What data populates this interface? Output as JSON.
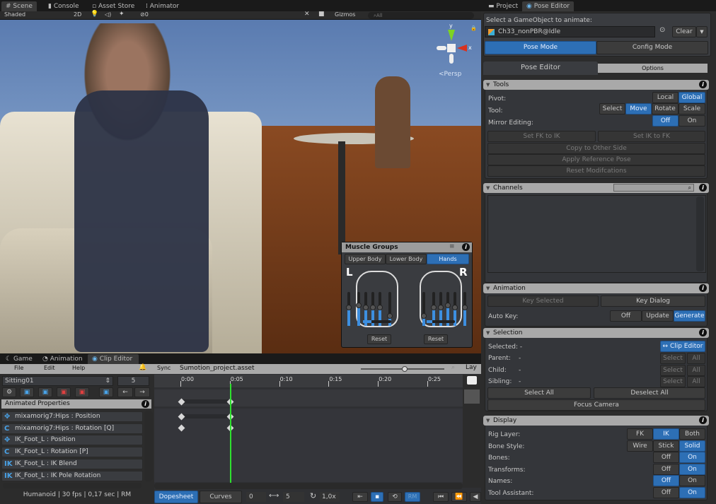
{
  "scene_panel": {
    "tabs": [
      "Scene",
      "Console",
      "Asset Store",
      "Animator"
    ],
    "shading": "Shaded",
    "mode_2d": "2D",
    "hidden_count": "0",
    "gizmos": "Gizmos",
    "search_placeholder": "All",
    "projection": "Persp",
    "axis_y": "y",
    "axis_x": "x"
  },
  "muscle_groups": {
    "title": "Muscle Groups",
    "tabs": [
      "Upper Body",
      "Lower Body",
      "Hands"
    ],
    "active_tab": "Hands",
    "left_label": "L",
    "right_label": "R",
    "reset": "Reset",
    "left_sliders": [
      0.55,
      0.6,
      0.55,
      0.55,
      0.55,
      0.3
    ],
    "right_sliders": [
      0.3,
      0.55,
      0.55,
      0.6,
      0.55,
      0.55
    ],
    "left_spread": 0.3,
    "right_spread": 0.2
  },
  "right_panel": {
    "tabs": [
      "Project",
      "Pose Editor"
    ],
    "select_label": "Select a GameObject to animate:",
    "object_name": "Ch33_nonPBR@Idle",
    "clear": "Clear",
    "modes": [
      "Pose Mode",
      "Config Mode"
    ],
    "active_mode": "Pose Mode",
    "subtabs": [
      "Pose Editor",
      "Options"
    ],
    "tools": {
      "title": "Tools",
      "pivot_label": "Pivot:",
      "pivot_options": [
        "Local",
        "Global"
      ],
      "pivot_active": "Global",
      "tool_label": "Tool:",
      "tool_options": [
        "Select",
        "Move",
        "Rotate",
        "Scale"
      ],
      "tool_active": "Move",
      "mirror_label": "Mirror Editing:",
      "mirror_options": [
        "Off",
        "On"
      ],
      "mirror_active": "Off",
      "buttons": [
        "Set FK to IK",
        "Set IK to FK",
        "Copy to Other Side",
        "Apply Reference Pose",
        "Reset Modifcations"
      ]
    },
    "channels": {
      "title": "Channels",
      "search_placeholder": ""
    },
    "animation": {
      "title": "Animation",
      "key_selected": "Key Selected",
      "key_dialog": "Key Dialog",
      "auto_key_label": "Auto Key:",
      "auto_key_options": [
        "Off",
        "Update",
        "Generate"
      ],
      "auto_key_active": "Generate"
    },
    "selection": {
      "title": "Selection",
      "selected_label": "Selected:",
      "selected_value": "-",
      "clip_editor": "↔ Clip Editor",
      "rows": [
        {
          "label": "Parent:",
          "value": "-"
        },
        {
          "label": "Child:",
          "value": "-"
        },
        {
          "label": "Sibling:",
          "value": "-"
        }
      ],
      "select": "Select",
      "all": "All",
      "select_all": "Select All",
      "deselect_all": "Deselect All",
      "focus_camera": "Focus Camera"
    },
    "display": {
      "title": "Display",
      "rows": [
        {
          "label": "Rig Layer:",
          "options": [
            "FK",
            "IK",
            "Both"
          ],
          "active": "IK"
        },
        {
          "label": "Bone Style:",
          "options": [
            "Wire",
            "Stick",
            "Solid"
          ],
          "active": "Solid"
        },
        {
          "label": "Bones:",
          "options": [
            "Off",
            "On"
          ],
          "active": "On"
        },
        {
          "label": "Transforms:",
          "options": [
            "Off",
            "On"
          ],
          "active": "On"
        },
        {
          "label": "Names:",
          "options": [
            "Off",
            "On"
          ],
          "active": "Off"
        },
        {
          "label": "Tool Assistant:",
          "options": [
            "Off",
            "On"
          ],
          "active": "On"
        }
      ]
    }
  },
  "bottom_panel": {
    "tabs": [
      "Game",
      "Animation",
      "Clip Editor"
    ],
    "menu": [
      "File",
      "Edit",
      "Help"
    ],
    "clip_name": "Sitting01",
    "frame_count": "5",
    "animated_properties": "Animated Properties",
    "properties": [
      {
        "icon": "move",
        "name": "mixamorig7:Hips : Position"
      },
      {
        "icon": "rotate",
        "name": "mixamorig7:Hips : Rotation [Q]"
      },
      {
        "icon": "move",
        "name": "IK_Foot_L : Position"
      },
      {
        "icon": "rotate",
        "name": "IK_Foot_L : Rotation [P]"
      },
      {
        "icon": "ik",
        "name": "IK_Foot_L : IK Blend"
      },
      {
        "icon": "ik",
        "name": "IK_Foot_L : IK Pole Rotation"
      }
    ],
    "status": "Humanoid | 30 fps | 0,17 sec | RM",
    "sync": "Sync",
    "project_file": "Sumotion_project.asset",
    "layers": "Lay",
    "timeline_ticks": [
      "0:00",
      "0:05",
      "0:10",
      "0:15",
      "0:20",
      "0:25"
    ],
    "bottom_tabs": [
      "Dopesheet",
      "Curves"
    ],
    "start_frame": "0",
    "length": "5",
    "speed": "1,0x",
    "rm": "RM"
  }
}
